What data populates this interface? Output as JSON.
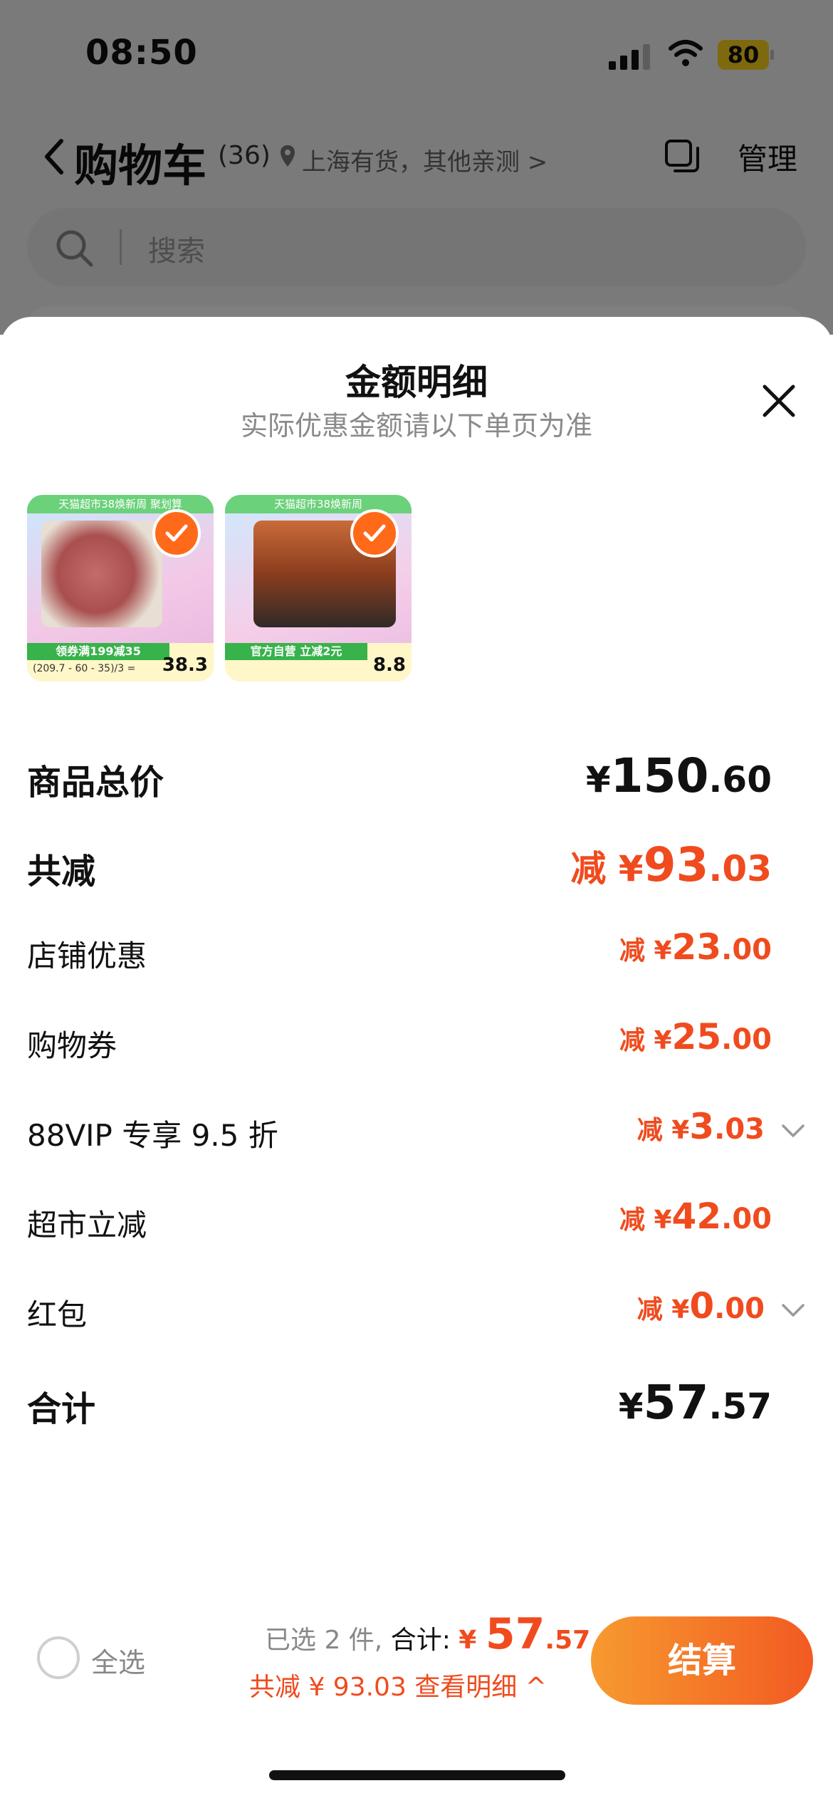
{
  "status_bar": {
    "time": "08:50",
    "battery": "80"
  },
  "nav": {
    "title": "购物车",
    "count": "(36)",
    "location": "上海有货，其他亲测 >",
    "manage": "管理"
  },
  "search": {
    "placeholder": "搜索"
  },
  "sheet": {
    "title": "金额明细",
    "subtitle": "实际优惠金额请以下单页为准",
    "products": [
      {
        "banner": "天猫超市38焕新周 聚划算",
        "deal_label": "领券满199减35",
        "deal_small": "(209.7 - 60 - 35)/3 =",
        "deal_price": "38.3"
      },
      {
        "banner": "天猫超市38焕新周",
        "deal_label": "官方自营 立减2元",
        "deal_small": "",
        "deal_price": "8.8"
      }
    ],
    "rows": [
      {
        "label": "商品总价",
        "prefix": "",
        "currency": "¥",
        "main": "150",
        "sub": ".60"
      },
      {
        "label": "共减",
        "prefix": "减 ",
        "currency": "¥",
        "main": "93",
        "sub": ".03"
      },
      {
        "label": "店铺优惠",
        "prefix": "减 ",
        "currency": "¥",
        "main": "23",
        "sub": ".00"
      },
      {
        "label": "购物券",
        "prefix": "减 ",
        "currency": "¥",
        "main": "25",
        "sub": ".00"
      },
      {
        "label": "88VIP 专享 9.5 折",
        "prefix": "减 ",
        "currency": "¥",
        "main": "3",
        "sub": ".03"
      },
      {
        "label": "超市立减",
        "prefix": "减 ",
        "currency": "¥",
        "main": "42",
        "sub": ".00"
      },
      {
        "label": "红包",
        "prefix": "减 ",
        "currency": "¥",
        "main": "0",
        "sub": ".00"
      },
      {
        "label": "合计",
        "prefix": "",
        "currency": "¥",
        "main": "57",
        "sub": ".57"
      }
    ]
  },
  "bottom": {
    "select_all": "全选",
    "selected": "已选 2 件,",
    "total_label": "合计:",
    "currency": "¥",
    "total_main": "57",
    "total_sub": ".57",
    "saving": "共减 ¥ 93.03  查看明细 ^",
    "checkout": "结算"
  },
  "colors": {
    "accent": "#f04b1e",
    "checkout_start": "#f79a2f",
    "checkout_end": "#f25a22"
  }
}
